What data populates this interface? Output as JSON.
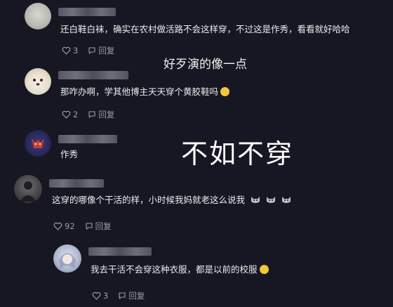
{
  "overlay": {
    "caption": "好歹演的像一点",
    "big": "不如不穿"
  },
  "comments": [
    {
      "text": "还白鞋白袜，确实在农村做活路不会这样穿，不过这是作秀，看看就好哈哈",
      "likes": "3",
      "reply": "回复"
    },
    {
      "text": "那咋办啊，学其他博主天天穿个黄胶鞋吗",
      "likes": "2",
      "reply": "回复"
    },
    {
      "text": "作秀"
    },
    {
      "text": "这穿的哪像个干活的样，小时候我妈就老这么说我",
      "likes": "92",
      "reply": "回复"
    },
    {
      "text": "我去干活不会穿这种衣服，都是以前的校服",
      "likes": "3",
      "reply": "回复"
    }
  ],
  "icons": {
    "like": "heart-outline-icon",
    "reply": "speech-bubble-icon"
  },
  "colors": {
    "background": "#161722",
    "text": "#ececf0",
    "muted": "#9c9da8"
  }
}
